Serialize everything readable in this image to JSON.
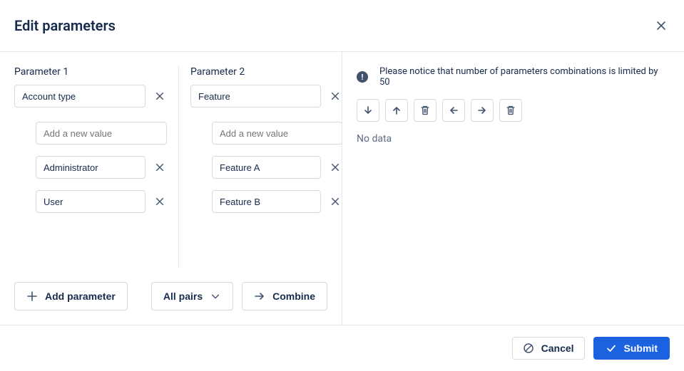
{
  "header": {
    "title": "Edit parameters"
  },
  "params": [
    {
      "label": "Parameter 1",
      "name": "Account type",
      "new_value_placeholder": "Add a new value",
      "values": [
        "Administrator",
        "User"
      ]
    },
    {
      "label": "Parameter 2",
      "name": "Feature",
      "new_value_placeholder": "Add a new value",
      "values": [
        "Feature A",
        "Feature B"
      ]
    }
  ],
  "left_footer": {
    "add_parameter": "Add parameter",
    "dropdown": "All pairs",
    "combine": "Combine"
  },
  "right": {
    "notice": "Please notice that number of parameters combinations is limited by 50",
    "no_data": "No data"
  },
  "footer": {
    "cancel": "Cancel",
    "submit": "Submit"
  }
}
